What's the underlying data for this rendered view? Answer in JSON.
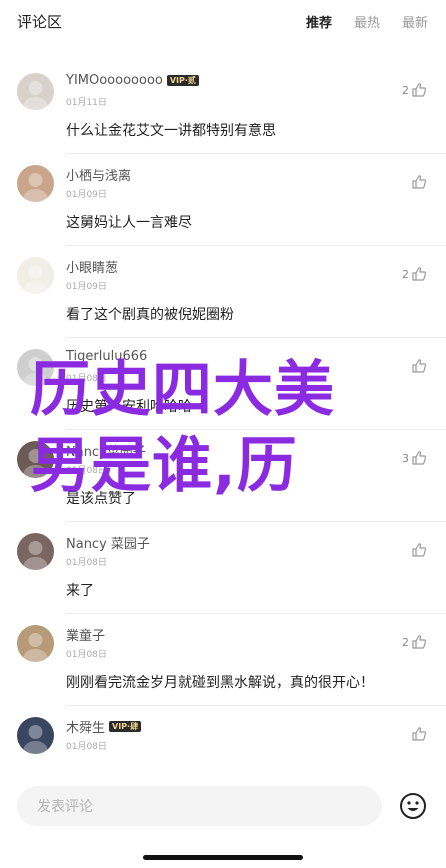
{
  "header": {
    "title": "评论区",
    "tabs": [
      "推荐",
      "最热",
      "最新"
    ],
    "active_tab": "推荐"
  },
  "comments": [
    {
      "nickname": "YIMOoooooooo",
      "vip": "VIP·贰",
      "date": "01月11日",
      "text": "什么让金花艾文一讲都特别有意思",
      "likes": "2",
      "avatar_color": "#d8d2cb"
    },
    {
      "nickname": "小栖与浅离",
      "vip": "",
      "date": "01月09日",
      "text": "这舅妈让人一言难尽",
      "likes": "",
      "avatar_color": "#c9a58b"
    },
    {
      "nickname": "小眼睛葱",
      "vip": "",
      "date": "01月09日",
      "text": "看了这个剧真的被倪妮圈粉",
      "likes": "2",
      "avatar_color": "#f1eee5"
    },
    {
      "nickname": "Tigerlulu666",
      "vip": "",
      "date": "01月08日",
      "text": "历史第一安利哈哈哈",
      "likes": "",
      "avatar_color": "#cfcfcf"
    },
    {
      "nickname": "Nancy菜园子",
      "vip": "",
      "date": "01月08日",
      "text": "是该点赞了",
      "likes": "3",
      "avatar_color": "#6b5a55"
    },
    {
      "nickname": "Nancy 菜园子",
      "vip": "",
      "date": "01月08日",
      "text": "来了",
      "likes": "",
      "avatar_color": "#7a6560"
    },
    {
      "nickname": "業童子",
      "vip": "",
      "date": "01月08日",
      "text": "刚刚看完流金岁月就碰到黑水解说，真的很开心！",
      "likes": "2",
      "avatar_color": "#b79a78"
    },
    {
      "nickname": "木舜生",
      "vip": "VIP·肆",
      "date": "01月08日",
      "text": "",
      "likes": "",
      "avatar_color": "#3a4660"
    }
  ],
  "overlay": {
    "line1": "历史四大美",
    "line2": "男是谁,历"
  },
  "input": {
    "placeholder": "发表评论"
  },
  "icons": {
    "like": "thumbs-up-icon",
    "emoji": "smiley-icon"
  },
  "colors": {
    "overlay": "#8a2be2",
    "vip_bg": "#2b2b2b",
    "vip_text": "#f1d28d"
  }
}
